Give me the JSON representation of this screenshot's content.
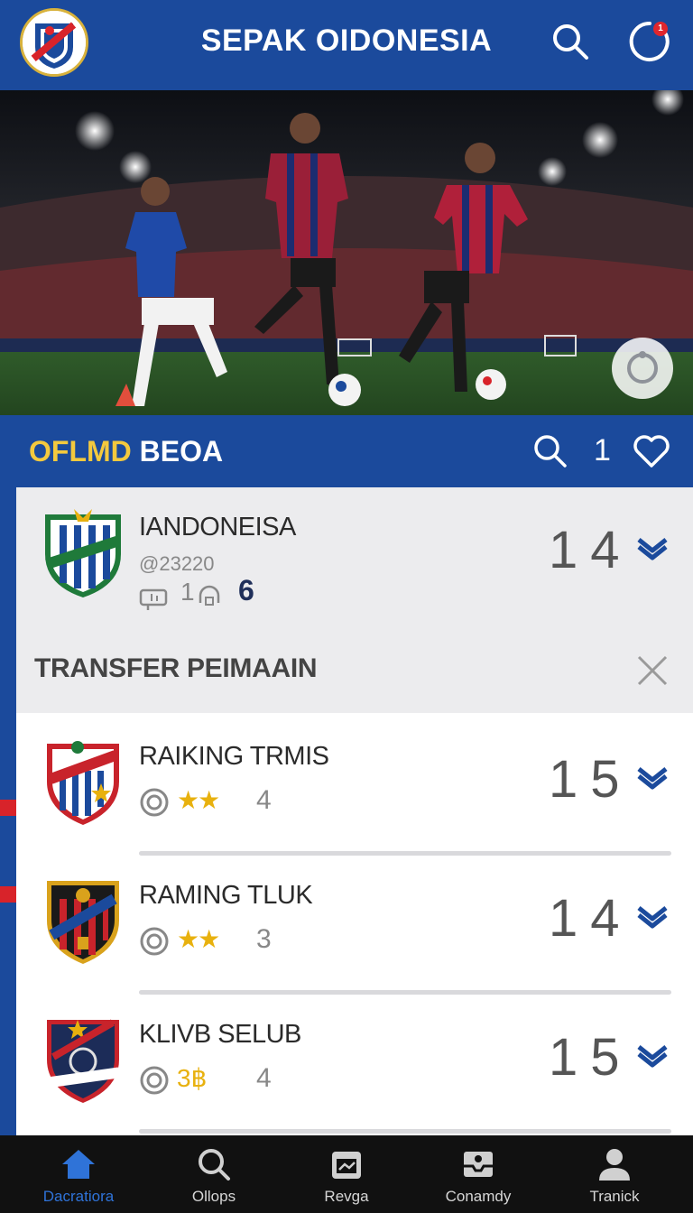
{
  "header": {
    "title": "SEPAK OIDONESIA",
    "notification_count": "1"
  },
  "subbar": {
    "title_part1": "OFLMD",
    "title_part2": "BEOA",
    "count": "1"
  },
  "featured": {
    "name": "IANDONEISA",
    "meta": "23220",
    "meta2_num": "1",
    "meta2_value": "6",
    "score": "14"
  },
  "transfer": {
    "label": "TRANSFER PEIMAAIN"
  },
  "list": [
    {
      "name": "RAIKING TRMIS",
      "stars": "★★",
      "rating_num": "4",
      "score": "15"
    },
    {
      "name": "RAMING TLUK",
      "stars": "★★",
      "rating_num": "3",
      "score": "14"
    },
    {
      "name": "KLIVB SELUB",
      "stars": "3฿",
      "rating_num": "4",
      "score": "15"
    }
  ],
  "nav": [
    {
      "label": "Dacratiora",
      "icon": "home-icon",
      "active": true
    },
    {
      "label": "Ollops",
      "icon": "search-icon",
      "active": false
    },
    {
      "label": "Revga",
      "icon": "calendar-icon",
      "active": false
    },
    {
      "label": "Conamdy",
      "icon": "inbox-icon",
      "active": false
    },
    {
      "label": "Tranick",
      "icon": "profile-icon",
      "active": false
    }
  ],
  "colors": {
    "brand_blue": "#1b4a9c",
    "accent_yellow": "#f3c93e",
    "active_nav": "#2f73d8",
    "alert_red": "#e0262d"
  }
}
